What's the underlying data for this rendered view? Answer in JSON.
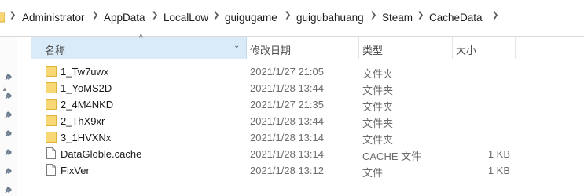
{
  "breadcrumb": [
    "Administrator",
    "AppData",
    "LocalLow",
    "guigugame",
    "guigubahuang",
    "Steam",
    "CacheData"
  ],
  "columns": {
    "name": "名称",
    "date": "修改日期",
    "type": "类型",
    "size": "大小"
  },
  "files": [
    {
      "name": "1_Tw7uwx",
      "date": "2021/1/27 21:05",
      "type": "文件夹",
      "size": "",
      "icon": "folder-icon"
    },
    {
      "name": "1_YoMS2D",
      "date": "2021/1/28 13:44",
      "type": "文件夹",
      "size": "",
      "icon": "folder-icon"
    },
    {
      "name": "2_4M4NKD",
      "date": "2021/1/27 21:35",
      "type": "文件夹",
      "size": "",
      "icon": "folder-icon"
    },
    {
      "name": "2_ThX9xr",
      "date": "2021/1/28 13:44",
      "type": "文件夹",
      "size": "",
      "icon": "folder-icon"
    },
    {
      "name": "3_1HVXNx",
      "date": "2021/1/28 13:14",
      "type": "文件夹",
      "size": "",
      "icon": "folder-icon"
    },
    {
      "name": "DataGloble.cache",
      "date": "2021/1/28 13:14",
      "type": "CACHE 文件",
      "size": "1 KB",
      "icon": "file-icon"
    },
    {
      "name": "FixVer",
      "date": "2021/1/28 13:12",
      "type": "文件",
      "size": "1 KB",
      "icon": "file-icon"
    }
  ],
  "colors": {
    "header_selected": "#d9ebf9",
    "folder": "#f8d775",
    "muted_text": "#6d6d6d"
  }
}
